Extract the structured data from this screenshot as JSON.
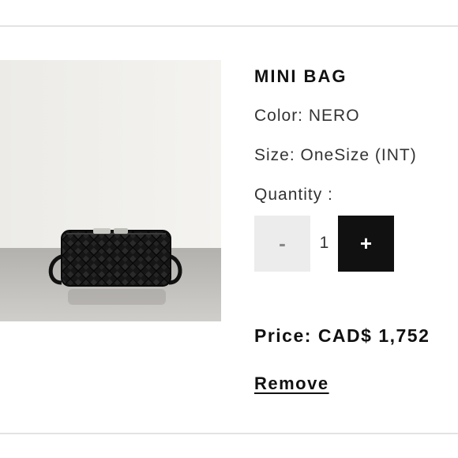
{
  "product": {
    "title": "MINI BAG",
    "image_alt": "black woven mini bag",
    "color_text": "Color: NERO",
    "size_text": "Size: OneSize (INT)",
    "quantity_label": "Quantity :",
    "quantity": {
      "minus_label": "-",
      "value": "1",
      "plus_label": "+"
    },
    "price_text": "Price: CAD$ 1,752",
    "remove_label": "Remove"
  },
  "colors": {
    "accent": "#111111",
    "minus_bg": "#ececec",
    "divider": "#e3e3e3"
  }
}
